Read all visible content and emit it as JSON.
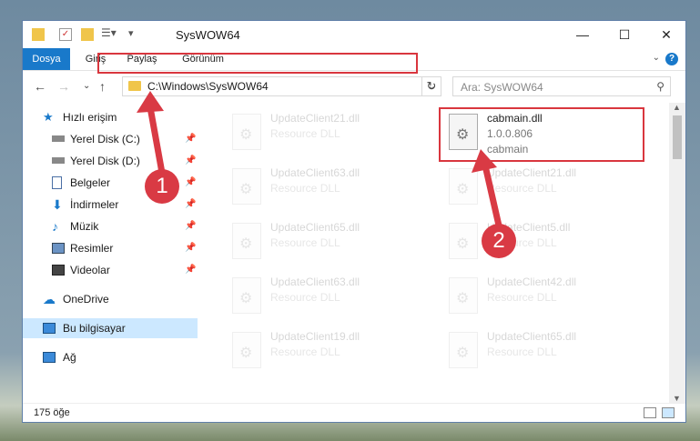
{
  "window": {
    "title": "SysWOW64"
  },
  "ribbon": {
    "tabs": [
      "Dosya",
      "Giriş",
      "Paylaş",
      "Görünüm"
    ]
  },
  "address": {
    "path": "C:\\Windows\\SysWOW64",
    "search_placeholder": "Ara: SysWOW64"
  },
  "sidebar": {
    "quick_access": "Hızlı erişim",
    "items": [
      "Yerel Disk (C:)",
      "Yerel Disk (D:)",
      "Belgeler",
      "İndirmeler",
      "Müzik",
      "Resimler",
      "Videolar"
    ],
    "onedrive": "OneDrive",
    "this_pc": "Bu bilgisayar",
    "network": "Ağ"
  },
  "files": {
    "left": [
      {
        "name": "UpdateClient21.dll",
        "desc": "Resource DLL"
      },
      {
        "name": "UpdateClient63.dll",
        "desc": "Resource DLL"
      },
      {
        "name": "UpdateClient65.dll",
        "desc": "Resource DLL"
      },
      {
        "name": "UpdateClient63.dll",
        "desc": "Resource DLL"
      },
      {
        "name": "UpdateClient19.dll",
        "desc": "Resource DLL"
      }
    ],
    "right": [
      {
        "name": "cabmain.dll",
        "version": "1.0.0.806",
        "desc": "cabmain"
      },
      {
        "name": "UpdateClient21.dll",
        "desc": "Resource DLL"
      },
      {
        "name": "UpdateClient5.dll",
        "desc": "Resource DLL"
      },
      {
        "name": "UpdateClient42.dll",
        "desc": "Resource DLL"
      },
      {
        "name": "UpdateClient65.dll",
        "desc": "Resource DLL"
      }
    ]
  },
  "status": {
    "count": "175 öğe"
  },
  "annotations": {
    "badge1": "1",
    "badge2": "2"
  },
  "colors": {
    "accent": "#1979ca",
    "highlight": "#d9363e"
  }
}
